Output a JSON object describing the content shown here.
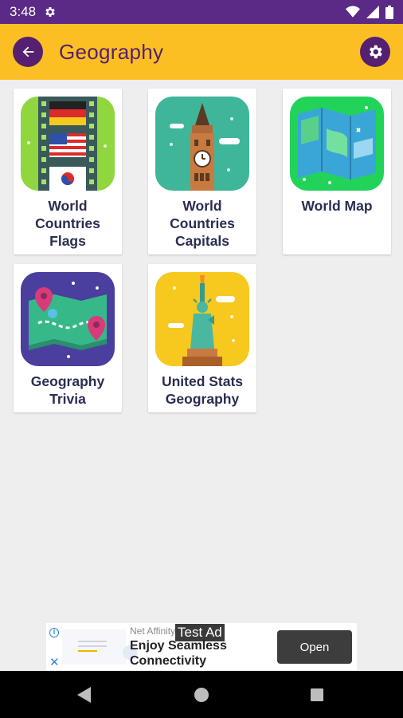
{
  "status_bar": {
    "time": "3:48",
    "icons": [
      "gear-icon",
      "wifi-icon",
      "signal-icon",
      "battery-icon"
    ]
  },
  "app_bar": {
    "title": "Geography",
    "back_icon": "back-arrow-icon",
    "settings_icon": "gear-icon",
    "colors": {
      "background": "#fbbf23",
      "accent": "#55206f"
    }
  },
  "categories": [
    {
      "label": "World Countries Flags",
      "icon": "flags-film-icon"
    },
    {
      "label": "World Countries Capitals",
      "icon": "big-ben-icon"
    },
    {
      "label": "World Map",
      "icon": "folded-map-icon"
    },
    {
      "label": "Geography Trivia",
      "icon": "map-pins-icon"
    },
    {
      "label": "United Stats Geography",
      "icon": "statue-of-liberty-icon"
    }
  ],
  "ad_banner": {
    "advertiser": "Net Affinity",
    "tag": "Test Ad",
    "headline": "Enjoy Seamless Connectivity",
    "cta_label": "Open",
    "info_icon": "info-icon",
    "close_icon": "close-icon"
  },
  "nav_bar": {
    "icons": [
      "back-triangle-icon",
      "home-circle-icon",
      "recents-square-icon"
    ]
  }
}
